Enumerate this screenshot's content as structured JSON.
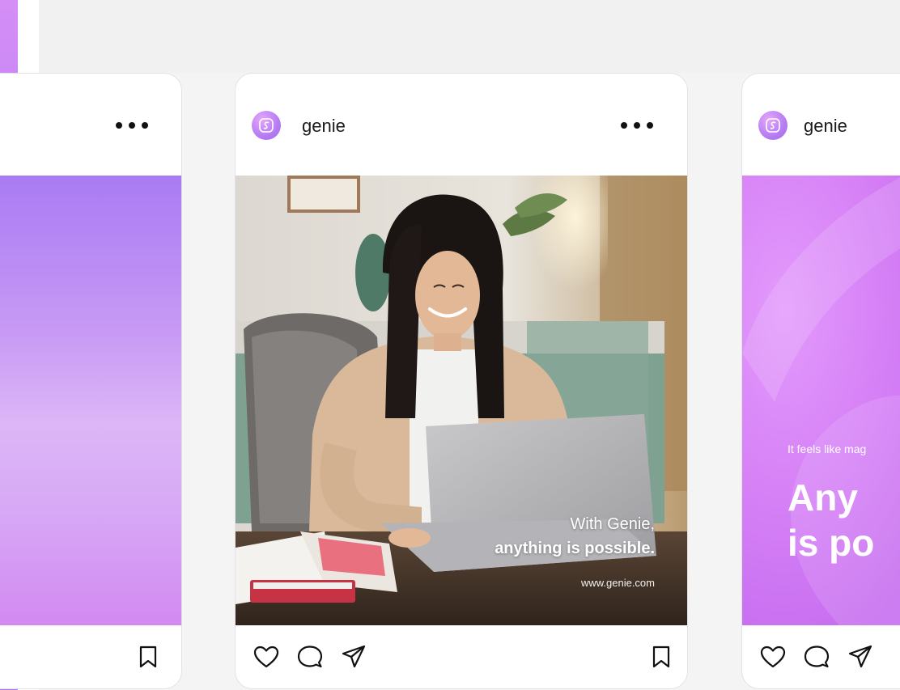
{
  "feed": {
    "left_post": {
      "more_label": "More options"
    },
    "center_post": {
      "username": "genie",
      "caption_line1": "With Genie,",
      "caption_line2": "anything is possible.",
      "caption_url": "www.genie.com"
    },
    "right_post": {
      "username": "genie",
      "tagline": "It feels like mag",
      "headline_line1": "Any",
      "headline_line2": "is po"
    }
  },
  "icons": {
    "more": "more-horizontal-icon",
    "like": "heart-icon",
    "comment": "comment-icon",
    "share": "send-icon",
    "save": "bookmark-icon",
    "avatar": "genie-logo-icon"
  },
  "colors": {
    "brand_purple": "#b67cf2",
    "brand_pink": "#e39afc",
    "background": "#f4f4f5",
    "card": "#ffffff"
  }
}
